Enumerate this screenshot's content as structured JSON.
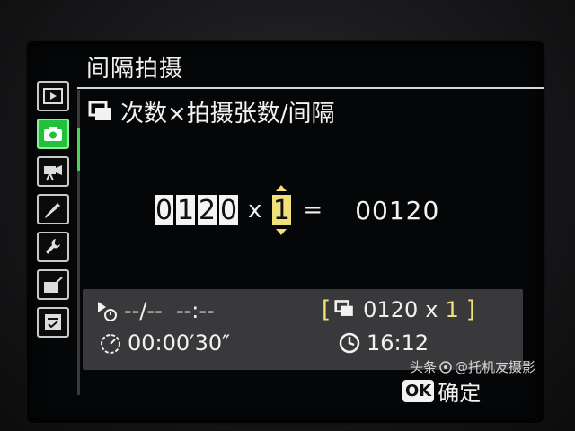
{
  "menu": {
    "title": "间隔拍摄"
  },
  "subtitle": {
    "text": "次数×拍摄张数/间隔"
  },
  "interval": {
    "count_digits": [
      "0",
      "1",
      "2",
      "0"
    ],
    "multiply_sign": "x",
    "shots": "1",
    "equals_sign": "=",
    "total": "00120"
  },
  "info": {
    "start_time": "--/--  --:--",
    "interval_time": "00:00′30″",
    "summary_count": "0120",
    "summary_x": "x",
    "summary_shots": "1",
    "duration": "16:12"
  },
  "footer": {
    "ok_badge": "OK",
    "ok_label": "确定",
    "watermark_prefix": "头条",
    "watermark_handle": "@托机友摄影"
  },
  "colors": {
    "active_tab": "#22c13a",
    "highlight": "#f1e07a",
    "info_bg": "#39393b"
  },
  "icons": [
    "playback-icon",
    "camera-icon",
    "movie-camera-icon",
    "pencil-icon",
    "wrench-icon",
    "retouch-icon",
    "my-menu-icon"
  ]
}
